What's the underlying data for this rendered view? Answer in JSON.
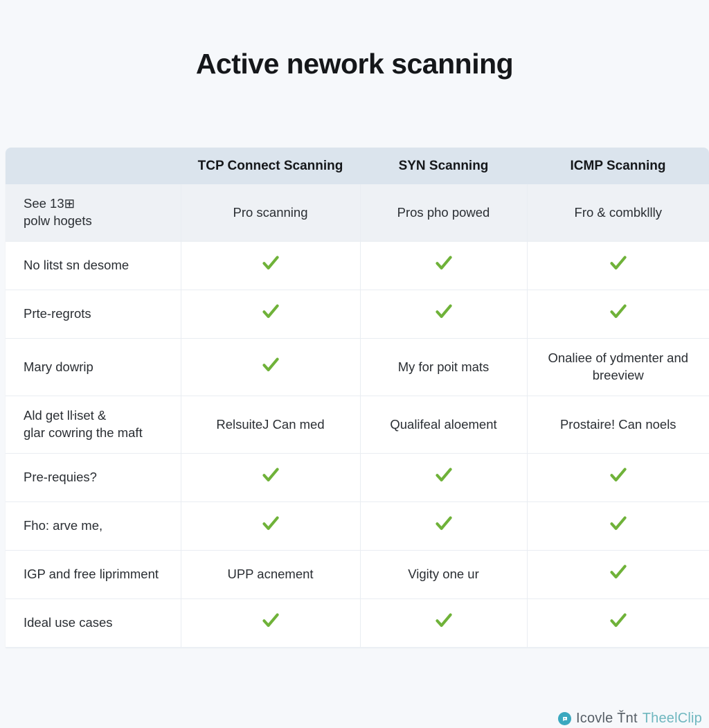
{
  "page": {
    "title": "Active nework scanning",
    "background_color": "#f6f8fb"
  },
  "colors": {
    "header_bg": "#dbe4ed",
    "check_green": "#6fb239",
    "row_shaded_bg": "#eef1f5",
    "border": "#e9edf2",
    "brand_teal": "#3aa8bf"
  },
  "table": {
    "row_header_blank": "",
    "columns": [
      "TCP Connect Scanning",
      "SYN Scanning",
      "ICMP Scanning"
    ],
    "rows": [
      {
        "label": "See 13⊞\npolw hogets",
        "shaded": true,
        "cells": [
          {
            "type": "text",
            "text": "Pro scanning"
          },
          {
            "type": "text",
            "text": "Pros pho powed"
          },
          {
            "type": "text",
            "text": "Fro & combkllly"
          }
        ]
      },
      {
        "label": "No litst sn desome",
        "shaded": false,
        "cells": [
          {
            "type": "check",
            "text": "✓"
          },
          {
            "type": "check",
            "text": "✓"
          },
          {
            "type": "check",
            "text": "✓"
          }
        ]
      },
      {
        "label": "Prte-regrots",
        "shaded": false,
        "cells": [
          {
            "type": "check",
            "text": "✓"
          },
          {
            "type": "check",
            "text": "✓"
          },
          {
            "type": "check",
            "text": "✓"
          }
        ]
      },
      {
        "label": "Mary dowrip",
        "shaded": false,
        "cells": [
          {
            "type": "check",
            "text": "✓"
          },
          {
            "type": "text",
            "text": "My for poit mats"
          },
          {
            "type": "text",
            "text": "Onaliee of ydmenter and breeview"
          }
        ]
      },
      {
        "label": "Ald get lŀiset &\nglar cowring the maft",
        "shaded": false,
        "cells": [
          {
            "type": "text",
            "text": "RelsuiteJ Can med"
          },
          {
            "type": "text",
            "text": "Qualifeal aloement"
          },
          {
            "type": "text",
            "text": "Prostaire! Can noels"
          }
        ]
      },
      {
        "label": "Pre-requies?",
        "shaded": false,
        "cells": [
          {
            "type": "check",
            "text": "✓"
          },
          {
            "type": "check",
            "text": "✓"
          },
          {
            "type": "check",
            "text": "✓"
          }
        ]
      },
      {
        "label": "Fho: arve me,",
        "shaded": false,
        "cells": [
          {
            "type": "check",
            "text": "✓"
          },
          {
            "type": "check",
            "text": "✓"
          },
          {
            "type": "check",
            "text": "✓"
          }
        ]
      },
      {
        "label": "IGP and free liprimment",
        "shaded": false,
        "cells": [
          {
            "type": "text",
            "text": "UPP acnement"
          },
          {
            "type": "text",
            "text": "Vigity one ur"
          },
          {
            "type": "check",
            "text": "✓"
          }
        ]
      },
      {
        "label": "Ideal use cases",
        "shaded": false,
        "cells": [
          {
            "type": "check",
            "text": "✓"
          },
          {
            "type": "check",
            "text": "✓"
          },
          {
            "type": "check",
            "text": "✓"
          }
        ]
      }
    ]
  },
  "footer": {
    "icon": "play-circle-icon",
    "brand_part1": "Icovle Ťnt",
    "brand_part2": "TheelClip"
  }
}
